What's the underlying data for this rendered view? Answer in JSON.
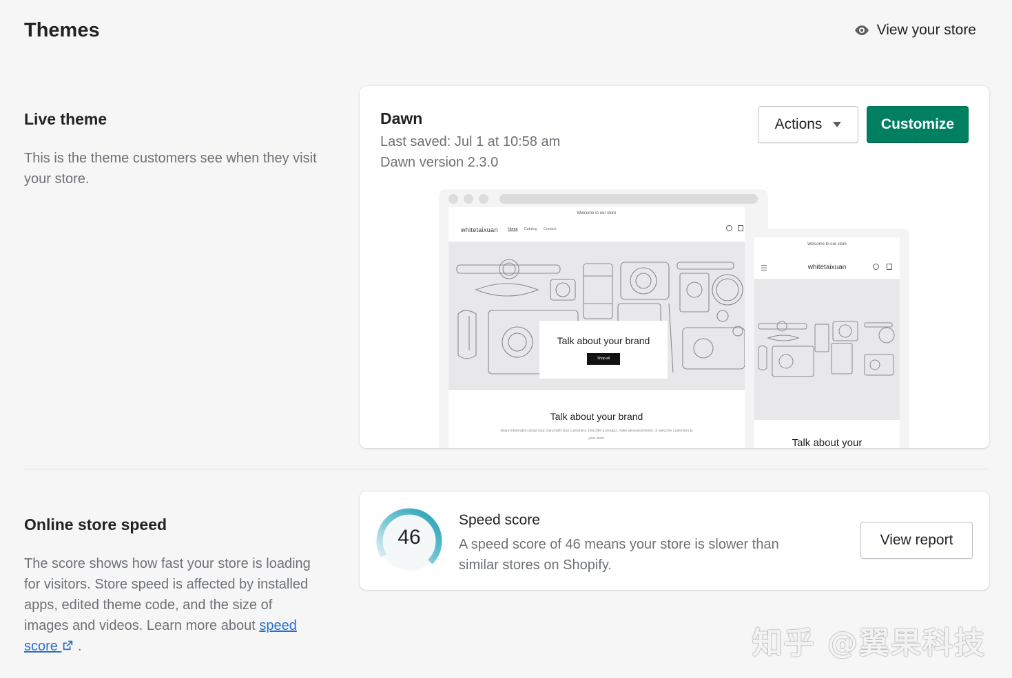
{
  "header": {
    "title": "Themes",
    "view_store_label": "View your store"
  },
  "live_theme": {
    "heading": "Live theme",
    "description": "This is the theme customers see when they visit your store.",
    "card": {
      "theme_name": "Dawn",
      "last_saved": "Last saved: Jul 1 at 10:58 am",
      "version": "Dawn version 2.3.0",
      "actions_label": "Actions",
      "customize_label": "Customize",
      "preview": {
        "announcement": "Welcome to our store",
        "store_name": "whitetaixuan",
        "nav": [
          "Home",
          "Catalog",
          "Contact"
        ],
        "hero_title": "Talk about your brand",
        "hero_button": "Shop all",
        "section_title": "Talk about your brand",
        "section_text": "Share information about your brand with your customers. Describe a product, make announcements, or welcome customers to your store.",
        "mobile_title": "Talk about your"
      }
    }
  },
  "speed": {
    "heading": "Online store speed",
    "description": "The score shows how fast your store is loading for visitors. Store speed is affected by installed apps, edited theme code, and the size of images and videos. Learn more about",
    "link_label": "speed score",
    "trailing": ".",
    "card": {
      "score": "46",
      "score_value": 46,
      "title": "Speed score",
      "description": "A speed score of 46 means your store is slower than similar stores on Shopify.",
      "report_label": "View report"
    }
  },
  "watermark": "知乎 @翼果科技",
  "colors": {
    "primary": "#008060",
    "link": "#2c6ecb",
    "gauge": "#29a3b8",
    "background": "#f6f6f7"
  },
  "icons": [
    "eye-icon",
    "caret-down-icon",
    "external-link-icon",
    "search-icon",
    "bag-icon",
    "menu-icon"
  ]
}
